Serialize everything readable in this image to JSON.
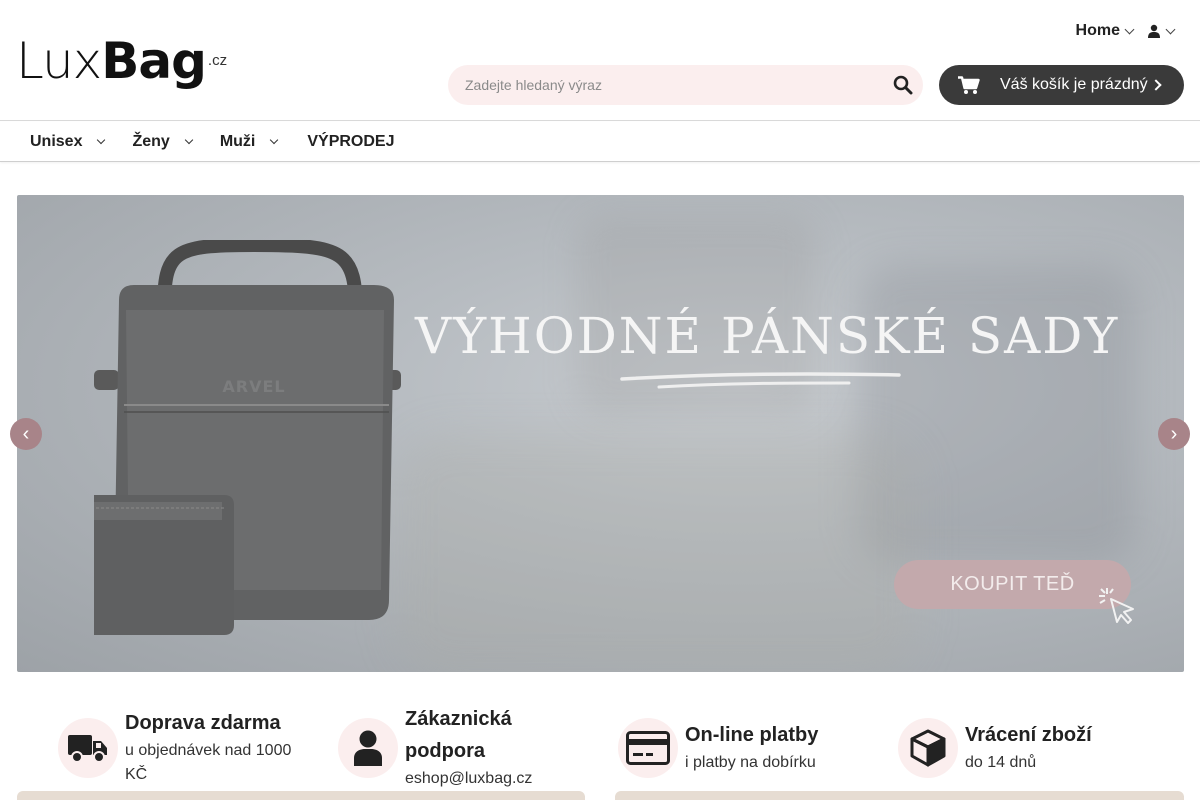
{
  "header": {
    "logo": {
      "part1": "Lux",
      "part2": "Bag",
      "tld": ".cz"
    },
    "home_label": "Home",
    "search": {
      "placeholder": "Zadejte hledaný výraz",
      "icon": "search-icon"
    },
    "cart": {
      "label": "Váš košík je prázdný",
      "icon": "cart-icon"
    },
    "user_icon": "user-icon"
  },
  "nav": {
    "items": [
      {
        "label": "Unisex",
        "has_dropdown": true
      },
      {
        "label": "Ženy",
        "has_dropdown": true
      },
      {
        "label": "Muži",
        "has_dropdown": true
      },
      {
        "label": "VÝPRODEJ",
        "has_dropdown": false
      }
    ]
  },
  "hero": {
    "title": "VÝHODNÉ PÁNSKÉ SADY",
    "cta": "KOUPIT TEĎ",
    "bag_brand": "ARVEL",
    "prev_label": "‹",
    "next_label": "›"
  },
  "features": [
    {
      "title": "Doprava zdarma",
      "subtitle": "u objednávek nad 1000 KČ",
      "icon": "truck-icon"
    },
    {
      "title": "Zákaznická podpora",
      "subtitle": "eshop@luxbag.cz",
      "icon": "person-icon"
    },
    {
      "title": "On-line platby",
      "subtitle": "i platby na dobírku",
      "icon": "credit-card-icon"
    },
    {
      "title": "Vrácení zboží",
      "subtitle": "do 14 dnů",
      "icon": "box-icon"
    }
  ],
  "colors": {
    "accent_pink": "#fbeeee",
    "cart_bg": "#3a3a3a",
    "cta_bg": "#c3a9ac",
    "arrow_bg": "#a88489"
  }
}
